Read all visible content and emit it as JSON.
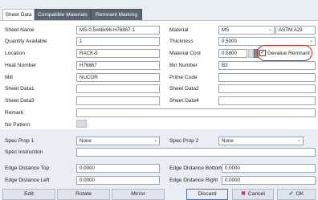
{
  "tabs": [
    {
      "label": "Sheet Data",
      "active": true
    },
    {
      "label": "Compatible Materials",
      "active": false
    },
    {
      "label": "Remnant Marking",
      "active": false
    }
  ],
  "left": {
    "sheet_name_label": "Sheet Name",
    "sheet_name_value": "MS-0.5x48x96-H76867-1",
    "quantity_label": "Quantity Available",
    "quantity_value": "1",
    "location_label": "Location",
    "location_value": "RACK-5",
    "heat_label": "Heat Number",
    "heat_value": "H76867",
    "mill_label": "Mill",
    "mill_value": "NUCOR",
    "sd1_label": "Sheet Data1",
    "sd3_label": "Sheet Data3",
    "remark_label": "Remark",
    "nopattern_label": "No Pattern"
  },
  "right": {
    "material_label": "Material",
    "material_value": "MS",
    "material_spec": "ASTM A29",
    "thickness_label": "Thickness",
    "thickness_value": "0.5000",
    "cost_label": "Material Cost",
    "cost_value": "0.5800",
    "devalue_label": "Devalue Remnant",
    "devalue_checked": true,
    "bin_label": "Bin Number",
    "bin_value": "B2",
    "prime_label": "Prime Code",
    "sd2_label": "Sheet Data2",
    "sd4_label": "Sheet Data4"
  },
  "spec": {
    "prop1_label": "Spec Prop 1",
    "prop1_value": "None",
    "prop2_label": "Spec Prop 2",
    "prop2_value": "None",
    "instruction_label": "Spec Instruction"
  },
  "edge": {
    "top_label": "Edge Distance Top",
    "top_value": "0.0000",
    "left_label": "Edge Distance Left",
    "left_value": "0.0000",
    "bottom_label": "Edge Distance Bottom",
    "bottom_value": "0.0000",
    "right_label": "Edge Distance Right",
    "right_value": "0.0000"
  },
  "buttons": {
    "edit": "Edit",
    "rotate": "Rotate",
    "mirror": "Mirror",
    "discard": "Discard",
    "cancel": "Cancel",
    "ok": "OK",
    "cancel_icon": "x-icon",
    "ok_icon": "check-icon"
  },
  "colors": {
    "highlight": "#e0201b",
    "cancel_icon": "#d8261c",
    "ok_icon": "#2e9a2e"
  }
}
